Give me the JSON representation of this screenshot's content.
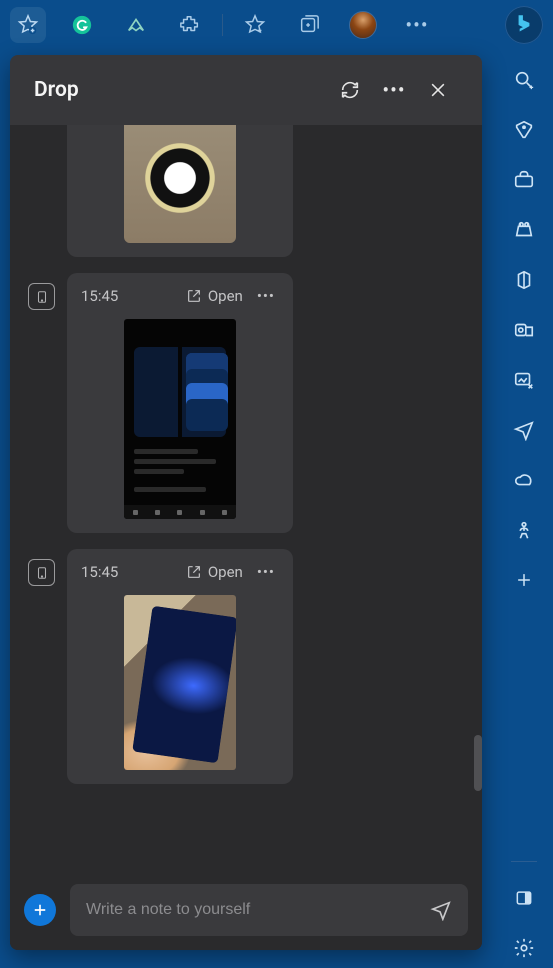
{
  "toolbar": {
    "items": [
      {
        "name": "favorites-add-icon",
        "active": true
      },
      {
        "name": "grammarly-icon"
      },
      {
        "name": "edge-extension-icon"
      },
      {
        "name": "extensions-icon"
      },
      {
        "sep": true
      },
      {
        "name": "favorites-icon"
      },
      {
        "name": "collections-icon"
      },
      {
        "name": "profile-avatar"
      },
      {
        "name": "more-actions-icon"
      }
    ],
    "bing": {
      "name": "bing-chat-icon"
    }
  },
  "sidebar": {
    "items": [
      {
        "name": "search-icon"
      },
      {
        "name": "shopping-icon"
      },
      {
        "name": "tools-icon"
      },
      {
        "name": "games-icon"
      },
      {
        "name": "m365-icon"
      },
      {
        "name": "outlook-icon"
      },
      {
        "name": "image-create-icon"
      },
      {
        "name": "drop-icon"
      },
      {
        "name": "weather-icon"
      },
      {
        "name": "meditate-icon"
      },
      {
        "name": "add-tool-icon"
      }
    ],
    "footer": [
      {
        "name": "hide-sidebar-icon"
      },
      {
        "name": "settings-icon"
      }
    ]
  },
  "drop": {
    "title": "Drop",
    "header_actions": {
      "refresh": "refresh-icon",
      "more": "more-icon",
      "close": "close-icon"
    },
    "messages": [
      {
        "time": "",
        "open": "",
        "image": "cake",
        "has_source": false,
        "partial_top": true
      },
      {
        "time": "15:45",
        "open": "Open",
        "image": "insta",
        "has_source": true
      },
      {
        "time": "15:45",
        "open": "Open",
        "image": "tablet",
        "has_source": true
      }
    ],
    "composer": {
      "add": "add-attachment-button",
      "placeholder": "Write a note to yourself",
      "send": "send-button"
    }
  }
}
